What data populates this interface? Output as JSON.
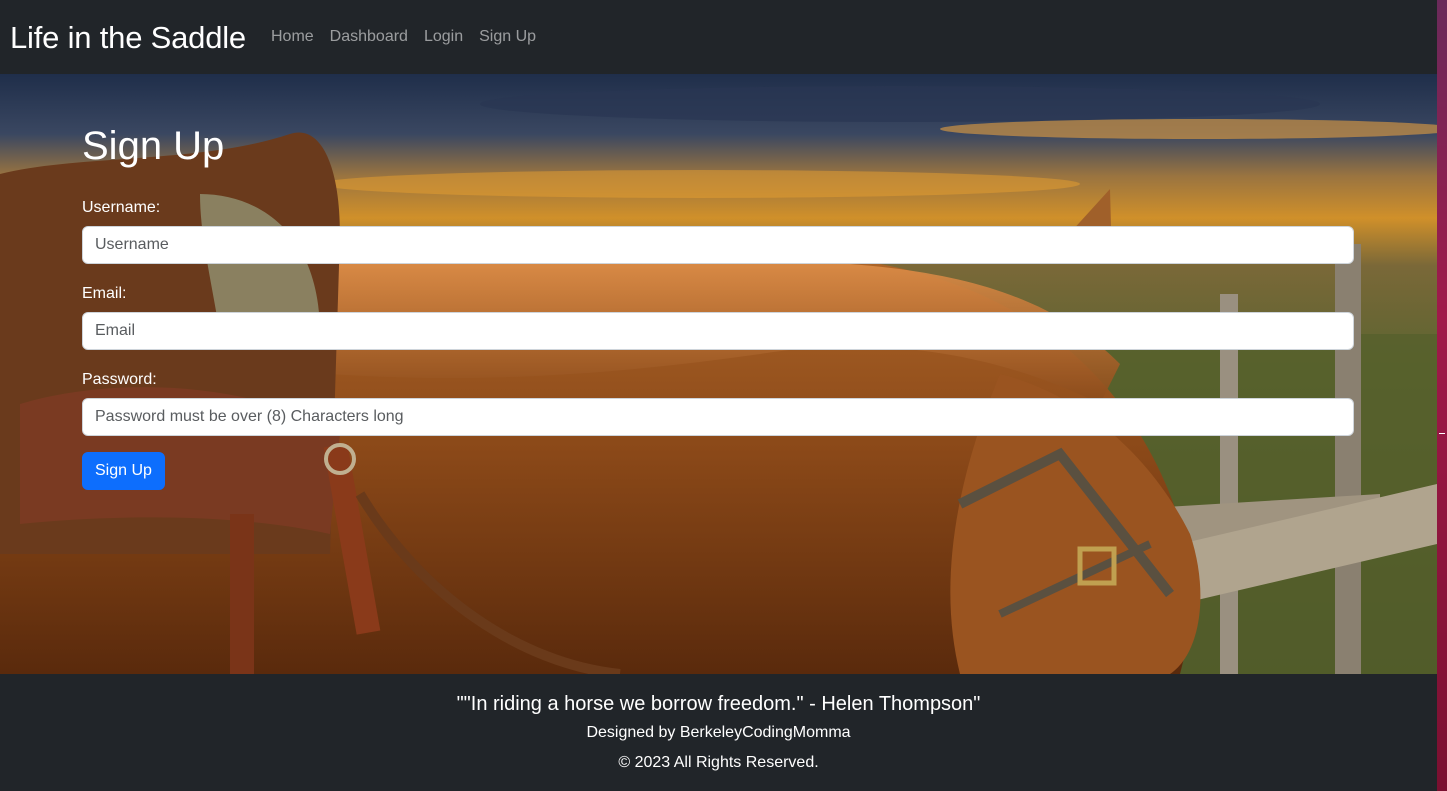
{
  "navbar": {
    "brand": "Life in the Saddle",
    "links": [
      {
        "label": "Home"
      },
      {
        "label": "Dashboard"
      },
      {
        "label": "Login"
      },
      {
        "label": "Sign Up"
      }
    ]
  },
  "form": {
    "title": "Sign Up",
    "username": {
      "label": "Username:",
      "placeholder": "Username",
      "value": ""
    },
    "email": {
      "label": "Email:",
      "placeholder": "Email",
      "value": ""
    },
    "password": {
      "label": "Password:",
      "placeholder": "Password must be over (8) Characters long",
      "value": ""
    },
    "submit_label": "Sign Up"
  },
  "footer": {
    "quote": "\"\"In riding a horse we borrow freedom.\" - Helen Thompson\"",
    "designed_by": "Designed by BerkeleyCodingMomma",
    "copyright": "© 2023 All Rights Reserved."
  },
  "colors": {
    "navbar_bg": "#212529",
    "primary_button": "#0d6efd",
    "nav_link": "rgba(255,255,255,0.55)"
  }
}
